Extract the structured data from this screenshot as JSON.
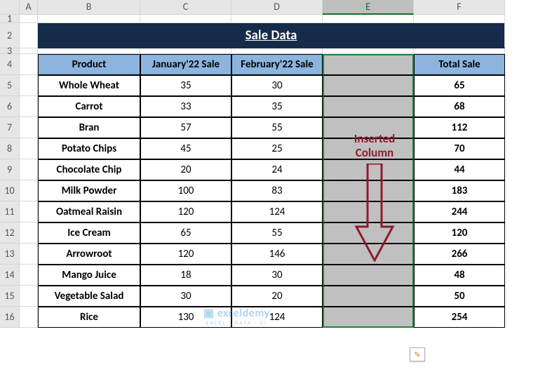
{
  "colHeaders": [
    "A",
    "B",
    "C",
    "D",
    "E",
    "F"
  ],
  "rowHeaders": [
    "1",
    "2",
    "3",
    "4",
    "5",
    "6",
    "7",
    "8",
    "9",
    "10",
    "11",
    "12",
    "13",
    "14",
    "15",
    "16"
  ],
  "title": "Sale Data",
  "headers": {
    "product": "Product",
    "jan": "January'22 Sale",
    "feb": "February'22 Sale",
    "inserted": "",
    "total": "Total Sale"
  },
  "rows": [
    {
      "product": "Whole Wheat",
      "jan": "35",
      "feb": "30",
      "total": "65"
    },
    {
      "product": "Carrot",
      "jan": "33",
      "feb": "35",
      "total": "68"
    },
    {
      "product": "Bran",
      "jan": "57",
      "feb": "55",
      "total": "112"
    },
    {
      "product": "Potato Chips",
      "jan": "45",
      "feb": "25",
      "total": "70"
    },
    {
      "product": "Chocolate Chip",
      "jan": "20",
      "feb": "24",
      "total": "44"
    },
    {
      "product": "Milk Powder",
      "jan": "100",
      "feb": "83",
      "total": "183"
    },
    {
      "product": "Oatmeal Raisin",
      "jan": "120",
      "feb": "124",
      "total": "244"
    },
    {
      "product": "Ice Cream",
      "jan": "65",
      "feb": "55",
      "total": "120"
    },
    {
      "product": "Arrowroot",
      "jan": "120",
      "feb": "146",
      "total": "266"
    },
    {
      "product": "Mango Juice",
      "jan": "18",
      "feb": "30",
      "total": "48"
    },
    {
      "product": "Vegetable Salad",
      "jan": "30",
      "feb": "20",
      "total": "50"
    },
    {
      "product": "Rice",
      "jan": "130",
      "feb": "124",
      "total": "254"
    }
  ],
  "annotation": {
    "line1": "Inserted",
    "line2": "Column"
  },
  "watermark": {
    "main": "exceldemy",
    "sub": "EXCEL · DATA · BI"
  },
  "chart_data": {
    "type": "table",
    "title": "Sale Data",
    "columns": [
      "Product",
      "January'22 Sale",
      "February'22 Sale",
      "Total Sale"
    ],
    "data": [
      [
        "Whole Wheat",
        35,
        30,
        65
      ],
      [
        "Carrot",
        33,
        35,
        68
      ],
      [
        "Bran",
        57,
        55,
        112
      ],
      [
        "Potato Chips",
        45,
        25,
        70
      ],
      [
        "Chocolate Chip",
        20,
        24,
        44
      ],
      [
        "Milk Powder",
        100,
        83,
        183
      ],
      [
        "Oatmeal Raisin",
        120,
        124,
        244
      ],
      [
        "Ice Cream",
        65,
        55,
        120
      ],
      [
        "Arrowroot",
        120,
        146,
        266
      ],
      [
        "Mango Juice",
        18,
        30,
        48
      ],
      [
        "Vegetable Salad",
        30,
        20,
        50
      ],
      [
        "Rice",
        130,
        124,
        254
      ]
    ]
  }
}
